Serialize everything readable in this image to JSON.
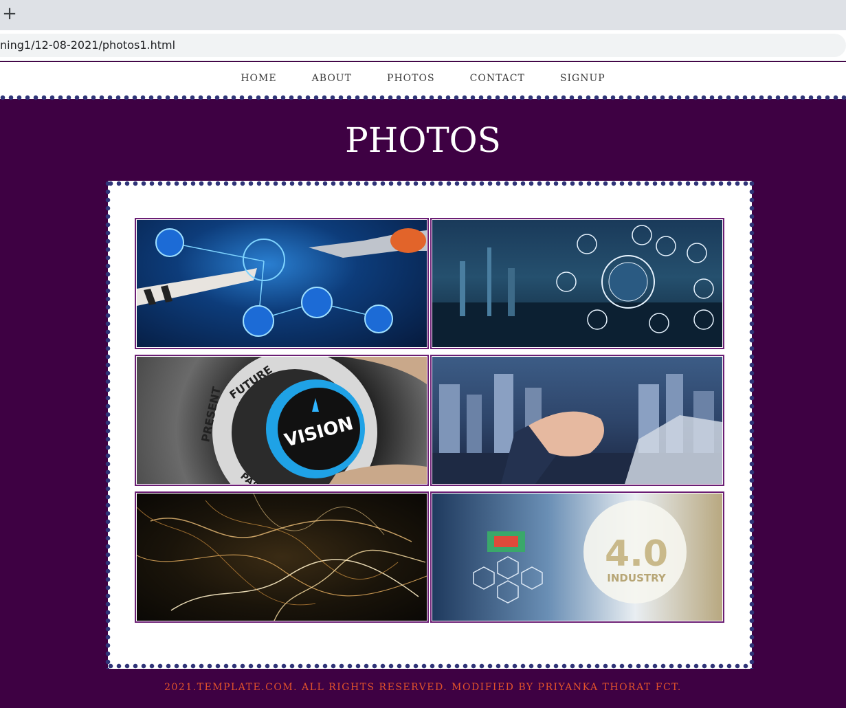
{
  "browser": {
    "new_tab_symbol": "+",
    "url": "ning1/12-08-2021/photos1.html"
  },
  "nav": {
    "items": [
      {
        "label": "HOME"
      },
      {
        "label": "ABOUT"
      },
      {
        "label": "PHOTOS"
      },
      {
        "label": "CONTACT"
      },
      {
        "label": "SIGNUP"
      }
    ]
  },
  "page": {
    "title": "PHOTOS"
  },
  "gallery": {
    "photos": [
      {
        "name": "tech-hands-photo"
      },
      {
        "name": "industry-network-photo",
        "text": ""
      },
      {
        "name": "vision-knob-photo",
        "knob_labels": [
          "PRESENT",
          "FUTURE",
          "PAST"
        ],
        "knob_text": "VISION"
      },
      {
        "name": "handshake-city-photo"
      },
      {
        "name": "light-trails-photo"
      },
      {
        "name": "industry-4-photo",
        "big_text": "4.0",
        "sub_text": "INDUSTRY"
      }
    ]
  },
  "footer": {
    "text": "2021.TEMPLATE.COM. ALL RIGHTS RESERVED. MODIFIED BY PRIYANKA THORAT FCT."
  },
  "colors": {
    "background": "#3e0143",
    "accent_border": "#6b1e74",
    "scallop": "#2f3478",
    "footer_text": "#e2532b"
  }
}
